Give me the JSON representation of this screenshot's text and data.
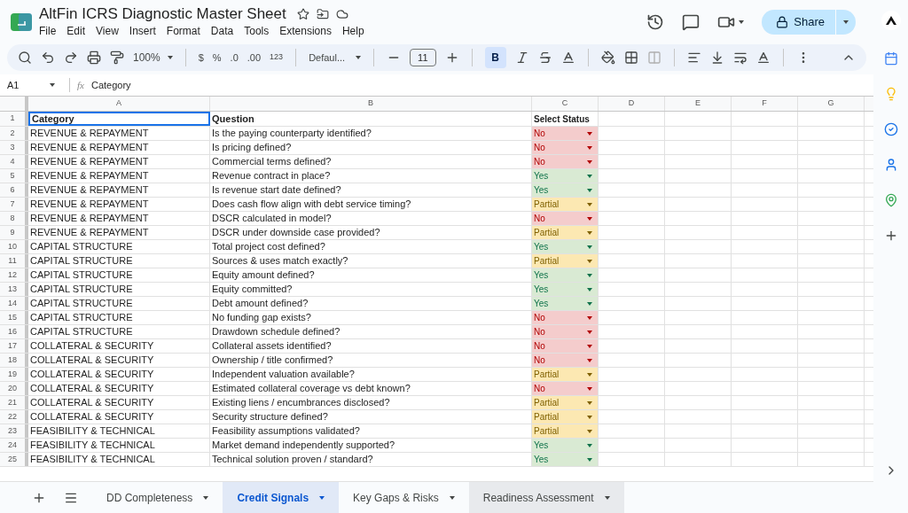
{
  "document": {
    "title": "AltFin ICRS Diagnostic Master Sheet",
    "menu": [
      "File",
      "Edit",
      "View",
      "Insert",
      "Format",
      "Data",
      "Tools",
      "Extensions",
      "Help"
    ],
    "share_label": "Share"
  },
  "toolbar": {
    "zoom": "100%",
    "currency": "$",
    "percent": "%",
    "decrease_decimal": ".0",
    "increase_decimal": ".00",
    "number_format": "123",
    "font": "Defaul...",
    "font_size": "11",
    "bold_label": "B",
    "bold_on": true
  },
  "formula_bar": {
    "cell": "A1",
    "fx_label": "fx",
    "formula": "Category"
  },
  "grid": {
    "columns": [
      "A",
      "B",
      "C",
      "D",
      "E",
      "F",
      "G"
    ],
    "header": {
      "number": "1",
      "category": "Category",
      "question": "Question",
      "status": "Select Status"
    },
    "rows": [
      {
        "number": "2",
        "category": "REVENUE & REPAYMENT",
        "question": "Is the paying counterparty identified?",
        "status": "No",
        "kind": "no"
      },
      {
        "number": "3",
        "category": "REVENUE & REPAYMENT",
        "question": "Is pricing defined?",
        "status": "No",
        "kind": "no"
      },
      {
        "number": "4",
        "category": "REVENUE & REPAYMENT",
        "question": "Commercial terms defined?",
        "status": "No",
        "kind": "no"
      },
      {
        "number": "5",
        "category": "REVENUE & REPAYMENT",
        "question": "Revenue contract in place?",
        "status": "Yes",
        "kind": "yes"
      },
      {
        "number": "6",
        "category": "REVENUE & REPAYMENT",
        "question": "Is revenue start date defined?",
        "status": "Yes",
        "kind": "yes"
      },
      {
        "number": "7",
        "category": "REVENUE & REPAYMENT",
        "question": "Does cash flow align with debt service timing?",
        "status": "Partial",
        "kind": "partial"
      },
      {
        "number": "8",
        "category": "REVENUE & REPAYMENT",
        "question": "DSCR calculated in model?",
        "status": "No",
        "kind": "no"
      },
      {
        "number": "9",
        "category": "REVENUE & REPAYMENT",
        "question": "DSCR under downside case provided?",
        "status": "Partial",
        "kind": "partial"
      },
      {
        "number": "10",
        "category": "CAPITAL STRUCTURE",
        "question": "Total project cost defined?",
        "status": "Yes",
        "kind": "yes"
      },
      {
        "number": "11",
        "category": "CAPITAL STRUCTURE",
        "question": "Sources & uses match exactly?",
        "status": "Partial",
        "kind": "partial"
      },
      {
        "number": "12",
        "category": "CAPITAL STRUCTURE",
        "question": "Equity amount defined?",
        "status": "Yes",
        "kind": "yes"
      },
      {
        "number": "13",
        "category": "CAPITAL STRUCTURE",
        "question": "Equity committed?",
        "status": "Yes",
        "kind": "yes"
      },
      {
        "number": "14",
        "category": "CAPITAL STRUCTURE",
        "question": "Debt amount defined?",
        "status": "Yes",
        "kind": "yes"
      },
      {
        "number": "15",
        "category": "CAPITAL STRUCTURE",
        "question": "No funding gap exists?",
        "status": "No",
        "kind": "no"
      },
      {
        "number": "16",
        "category": "CAPITAL STRUCTURE",
        "question": "Drawdown schedule defined?",
        "status": "No",
        "kind": "no"
      },
      {
        "number": "17",
        "category": "COLLATERAL & SECURITY",
        "question": "Collateral assets identified?",
        "status": "No",
        "kind": "no"
      },
      {
        "number": "18",
        "category": "COLLATERAL & SECURITY",
        "question": "Ownership / title confirmed?",
        "status": "No",
        "kind": "no"
      },
      {
        "number": "19",
        "category": "COLLATERAL & SECURITY",
        "question": "Independent valuation available?",
        "status": "Partial",
        "kind": "partial"
      },
      {
        "number": "20",
        "category": "COLLATERAL & SECURITY",
        "question": "Estimated collateral coverage vs debt known?",
        "status": "No",
        "kind": "no"
      },
      {
        "number": "21",
        "category": "COLLATERAL & SECURITY",
        "question": "Existing liens / encumbrances disclosed?",
        "status": "Partial",
        "kind": "partial"
      },
      {
        "number": "22",
        "category": "COLLATERAL & SECURITY",
        "question": "Security structure defined?",
        "status": "Partial",
        "kind": "partial"
      },
      {
        "number": "23",
        "category": "FEASIBILITY & TECHNICAL",
        "question": "Feasibility assumptions validated?",
        "status": "Partial",
        "kind": "partial"
      },
      {
        "number": "24",
        "category": "FEASIBILITY & TECHNICAL",
        "question": "Market demand independently supported?",
        "status": "Yes",
        "kind": "yes"
      },
      {
        "number": "25",
        "category": "FEASIBILITY & TECHNICAL",
        "question": "Technical solution proven / standard?",
        "status": "Yes",
        "kind": "yes"
      }
    ]
  },
  "sheet_tabs": [
    {
      "label": "DD Completeness",
      "selected": false,
      "hovered": false
    },
    {
      "label": "Credit Signals",
      "selected": true,
      "hovered": false
    },
    {
      "label": "Key Gaps & Risks",
      "selected": false,
      "hovered": false
    },
    {
      "label": "Readiness Assessment",
      "selected": false,
      "hovered": true
    }
  ]
}
